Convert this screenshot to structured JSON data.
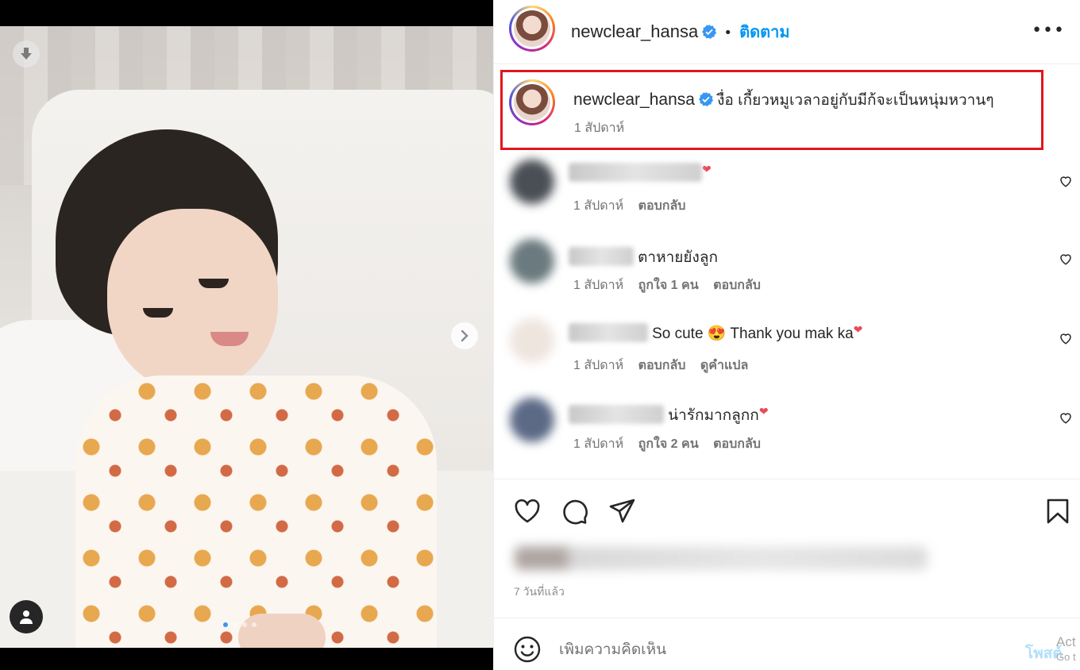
{
  "post": {
    "username": "newclear_hansa",
    "follow_label": "ติดตาม",
    "separator": "•",
    "more_label": "•••",
    "caption": {
      "username": "newclear_hansa",
      "text": "งื่อ เกี้ยวหมูเวลาอยู่กับมีก้จะเป็นหนุ่มหวานๆ",
      "time": "1 สัปดาห์"
    },
    "comments": [
      {
        "text": "",
        "time": "1 สัปดาห์",
        "likes": "",
        "reply": "ตอบกลับ",
        "translate": "",
        "heart": "❤"
      },
      {
        "text": "ตาหายยังลูก",
        "time": "1 สัปดาห์",
        "likes": "ถูกใจ 1 คน",
        "reply": "ตอบกลับ",
        "translate": "",
        "heart": ""
      },
      {
        "text": "So cute 😍 Thank you mak ka",
        "time": "1 สัปดาห์",
        "likes": "",
        "reply": "ตอบกลับ",
        "translate": "ดูคำแปล",
        "heart": "❤"
      },
      {
        "text": "น่ารักมากลูกก",
        "time": "1 สัปดาห์",
        "likes": "ถูกใจ 2 คน",
        "reply": "ตอบกลับ",
        "translate": "",
        "heart": "❤"
      }
    ],
    "posted_ago": "7 วันที่แล้ว",
    "add_comment_placeholder": "เพิ่มความคิดเห็น",
    "post_label": "โพสต์",
    "carousel_active_index": 0
  },
  "overlay": {
    "watermark_line1": "Act",
    "watermark_line2": "Go t"
  },
  "colors": {
    "accent_blue": "#0095f6",
    "highlight_red": "#e0161e",
    "like_red": "#ed4956"
  },
  "icons": [
    "download-icon",
    "chevron-right-icon",
    "user-tag-icon",
    "verified-badge-icon",
    "more-icon",
    "heart-icon",
    "comment-icon",
    "share-icon",
    "bookmark-icon",
    "emoji-icon"
  ]
}
